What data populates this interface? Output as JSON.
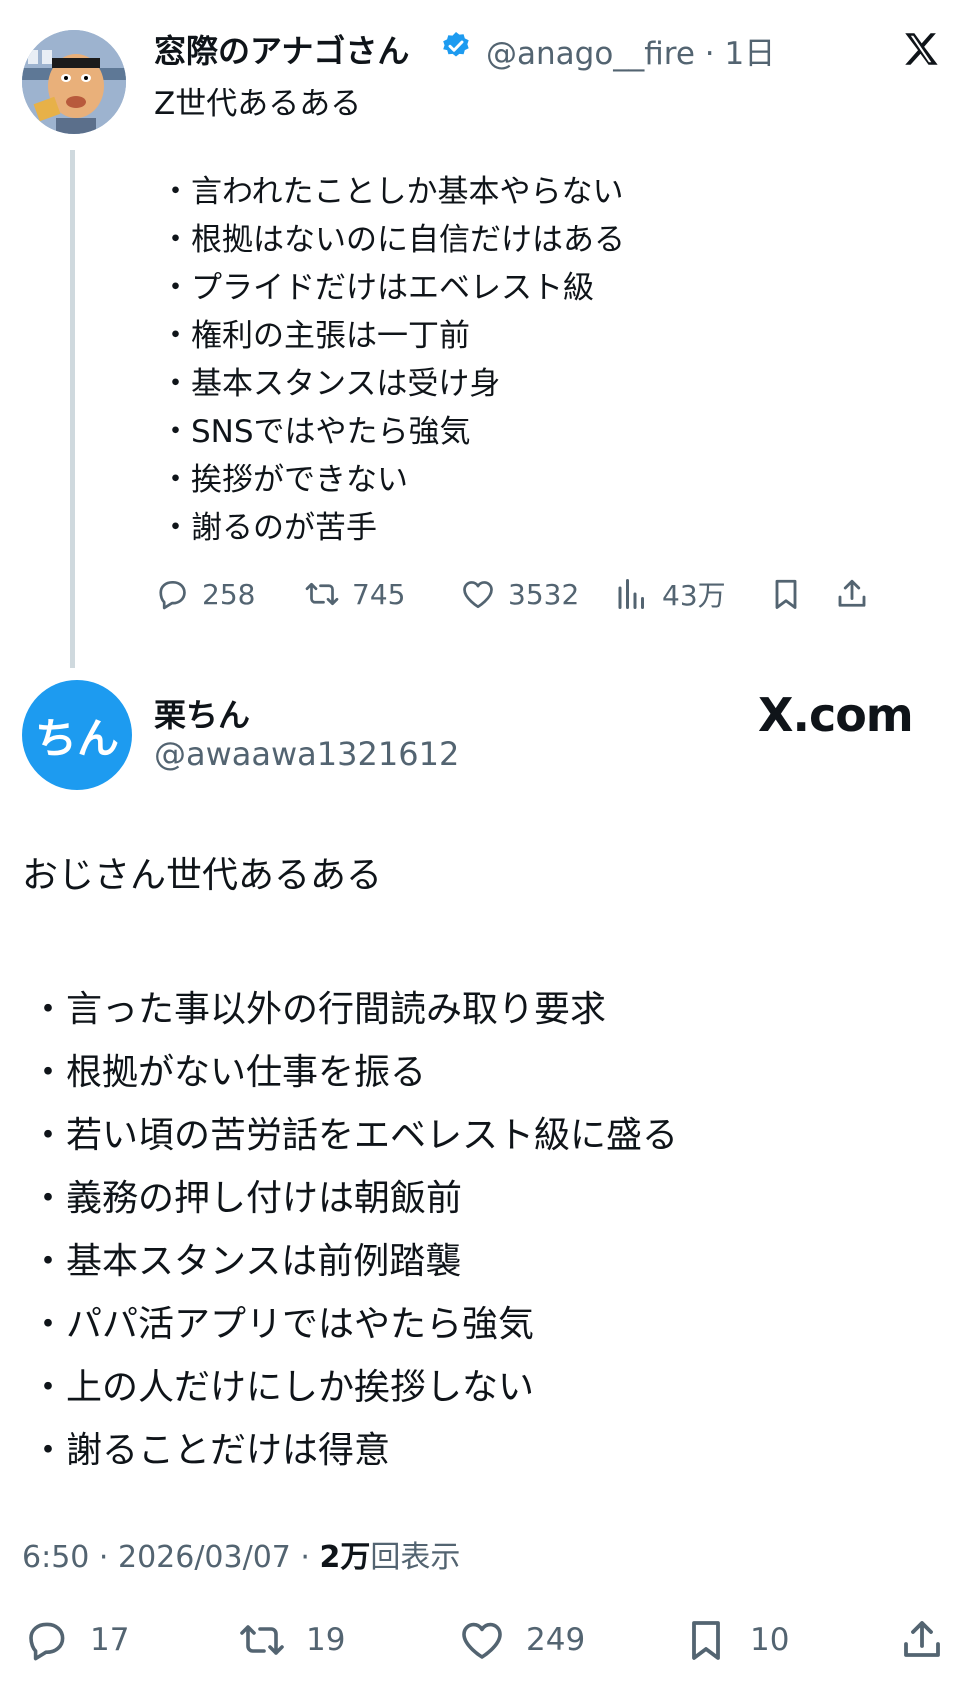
{
  "quoted_tweet": {
    "author_name": "窓際のアナゴさん",
    "handle_time": "@anago__fire · 1日",
    "intro": "Z世代あるある",
    "items": [
      "・言われたことしか基本やらない",
      "・根拠はないのに自信だけはある",
      "・プライドだけはエベレスト級",
      "・権利の主張は一丁前",
      "・基本スタンスは受け身",
      "・SNSではやたら強気",
      "・挨拶ができない",
      "・謝るのが苦手"
    ],
    "stats": {
      "replies": "258",
      "reposts": "745",
      "likes": "3532",
      "views": "43万"
    }
  },
  "main_tweet": {
    "avatar_text": "ちん",
    "author_name": "栗ちん",
    "handle": "@awaawa1321612",
    "watermark": "X.com",
    "intro": "おじさん世代あるある",
    "items": [
      "・言った事以外の行間読み取り要求",
      "・根拠がない仕事を振る",
      "・若い頃の苦労話をエベレスト級に盛る",
      "・義務の押し付けは朝飯前",
      "・基本スタンスは前例踏襲",
      "・パパ活アプリではやたら強気",
      "・上の人だけにしか挨拶しない",
      "・謝ることだけは得意"
    ],
    "timestamp": "6:50 · 2026/03/07 · ",
    "views_count": "2万",
    "views_label": "回表示",
    "stats": {
      "replies": "17",
      "reposts": "19",
      "likes": "249",
      "bookmarks": "10"
    }
  },
  "colors": {
    "verified_badge": "#1d9bf0",
    "avatar_bg": "#1d9bf0",
    "secondary_text": "#536471",
    "thread_line": "#cfd9de"
  }
}
